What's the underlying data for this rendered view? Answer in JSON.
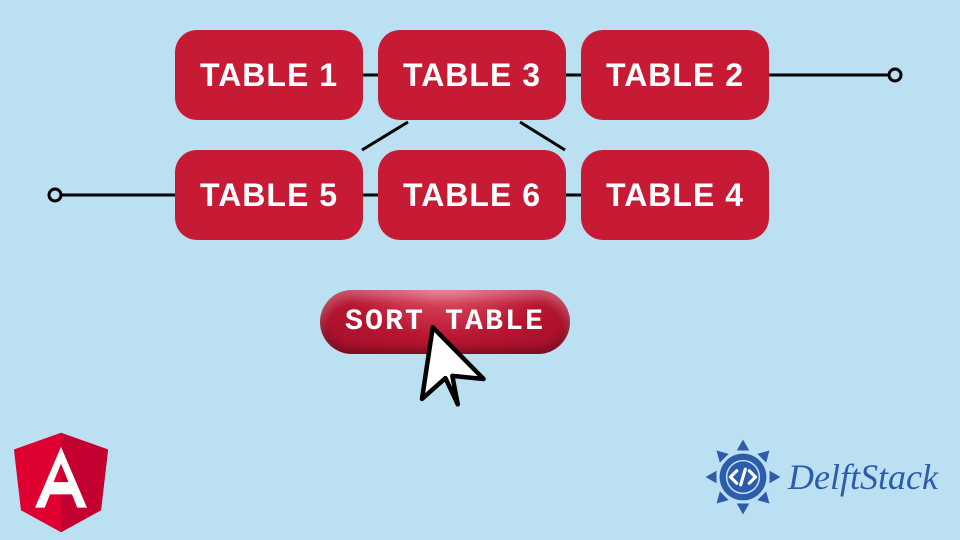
{
  "colors": {
    "background": "#bae0f2",
    "box_fill": "#c71b35",
    "box_text": "#ffffff",
    "wire": "#000000",
    "angular_red": "#dd0031",
    "angular_dark": "#c3002f",
    "delft_blue": "#2c5caa"
  },
  "boxes": {
    "r1c1": "TABLE 1",
    "r1c2": "TABLE 3",
    "r1c3": "TABLE 2",
    "r2c1": "TABLE 5",
    "r2c2": "TABLE 6",
    "r2c3": "TABLE 4"
  },
  "button": {
    "label": "SORT TABLE"
  },
  "logos": {
    "angular_letter": "A",
    "delft_text": "DelftStack"
  },
  "icons": {
    "cursor": "arrow-cursor-icon",
    "delft_badge": "code-badge-icon",
    "angular": "angular-shield-icon",
    "node_left": "wire-endpoint-left-icon",
    "node_right": "wire-endpoint-right-icon"
  }
}
